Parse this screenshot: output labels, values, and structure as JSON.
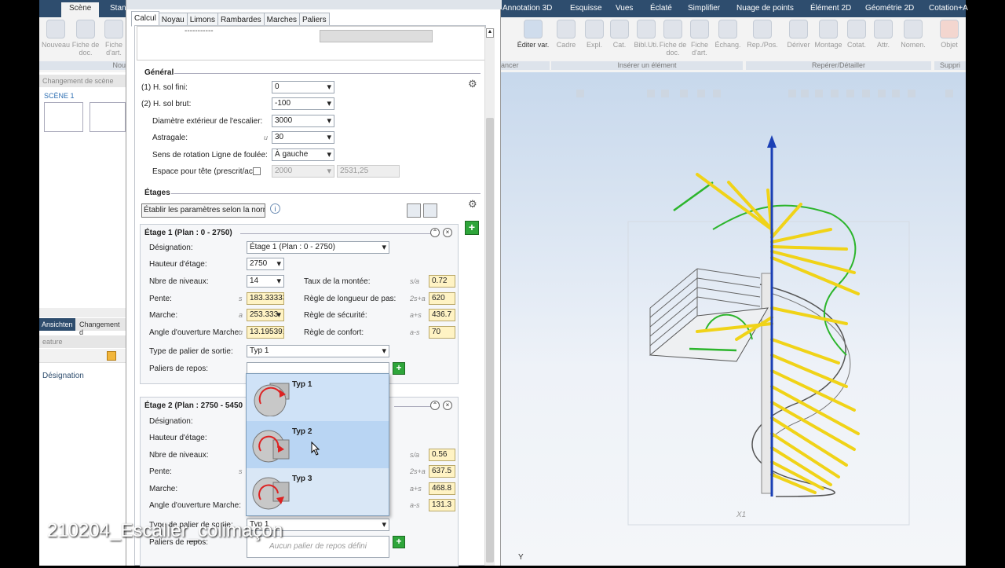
{
  "ribbon": {
    "tabs": [
      "Scène",
      "Stan",
      "Annotation 3D",
      "Esquisse",
      "Vues",
      "Éclaté",
      "Simplifier",
      "Nuage de points",
      "Élément 2D",
      "Géométrie 2D",
      "Cotation+A"
    ],
    "buttons_left": [
      "Nouveau",
      "Fiche de doc.",
      "Fiche d'art."
    ],
    "group_left": "Nou",
    "buttons_mid": [
      "Éditer var."
    ],
    "group_mid_left": "ancer",
    "buttons_insert": [
      "Cadre",
      "Expl.",
      "Cat.",
      "Bibl.Uti.",
      "Fiche de doc.",
      "Fiche d'art.",
      "Échang."
    ],
    "group_insert": "Insérer un élément",
    "buttons_rep": [
      "Rep./Pos.",
      "Dériver",
      "Montage",
      "Cotat.",
      "Attr.",
      "Nomen."
    ],
    "group_rep": "Repérer/Détailler",
    "buttons_right": [
      "Objet"
    ],
    "group_right": "Suppri"
  },
  "scene_pane": {
    "header": "Changement de scène",
    "scene_label": "SCÈNE 1",
    "tabs": [
      "Ansichten",
      "Changement d"
    ],
    "feature_header": "eature",
    "list_item": "Désignation"
  },
  "dialog": {
    "tabs": [
      "Calcul",
      "Noyau",
      "Limons",
      "Rambardes",
      "Marches",
      "Paliers"
    ],
    "active_tab": "Calcul",
    "top_dashes": "-----------",
    "general": {
      "title": "Général",
      "rows": [
        {
          "label": "(1) H. sol fini:",
          "value": "0"
        },
        {
          "label": "(2) H. sol brut:",
          "value": "-100"
        },
        {
          "label": "Diamètre extérieur de l'escalier:",
          "value": "3000"
        },
        {
          "label": "Astragale:",
          "unit": "u",
          "value": "30"
        },
        {
          "label": "Sens de rotation Ligne de foulée:",
          "value": "À gauche"
        },
        {
          "label": "Espace pour tête (prescrit/actu",
          "value": "2000",
          "value2": "2531,25"
        }
      ]
    },
    "etages": {
      "title": "Étages",
      "norm_button": "Établir les paramètres selon la norme"
    },
    "etage1": {
      "title": "Étage 1 (Plan : 0 - 2750)",
      "designation_label": "Désignation:",
      "designation_value": "Étage 1 (Plan : 0 - 2750)",
      "hauteur_label": "Hauteur d'étage:",
      "hauteur_value": "2750",
      "niveaux_label": "Nbre de niveaux:",
      "niveaux_value": "14",
      "taux_label": "Taux de la montée:",
      "taux_unit": "s/a",
      "taux_value": "0.72",
      "pente_label": "Pente:",
      "pente_unit": "s",
      "pente_value": "183.33333",
      "longueur_label": "Règle de longueur de pas:",
      "longueur_unit": "2s+a",
      "longueur_value": "620",
      "marche_label": "Marche:",
      "marche_unit": "a",
      "marche_value": "253.333",
      "securite_label": "Règle de sécurité:",
      "securite_unit": "a+s",
      "securite_value": "436.7",
      "angle_label": "Angle d'ouverture Marche:",
      "angle_unit": "α",
      "angle_value": "13.195391",
      "confort_label": "Règle de confort:",
      "confort_unit": "a-s",
      "confort_value": "70",
      "palier_label": "Type de palier de sortie:",
      "palier_value": "Typ 1",
      "repos_label": "Paliers de repos:"
    },
    "etage2": {
      "title": "Étage 2 (Plan : 2750 - 5450",
      "designation_label": "Désignation:",
      "hauteur_label": "Hauteur d'étage:",
      "niveaux_label": "Nbre de niveaux:",
      "taux_unit": "s/a",
      "taux_value": "0.56",
      "pente_label": "Pente:",
      "pente_unit": "s",
      "longueur_unit": "2s+a",
      "longueur_value": "637.5",
      "marche_label": "Marche:",
      "securite_unit": "a+s",
      "securite_value": "468.8",
      "angle_label": "Angle d'ouverture Marche:",
      "confort_unit": "a-s",
      "confort_value": "131.3",
      "palier_label": "Type de palier de sortie:",
      "palier_value": "Typ 1",
      "repos_label": "Paliers de repos:",
      "repos_value": "Aucun palier de repos défini"
    },
    "popup": [
      "Typ 1",
      "Typ 2",
      "Typ 3"
    ]
  },
  "viewport": {
    "axis_labels": [
      "X1",
      "Y"
    ]
  },
  "caption": "210204_Escalier_colimaçon",
  "colors": {
    "ribbon_tab_bg": "#2e4d6e",
    "highlight": "#cfe2f7",
    "field_yellow": "#fff3c4",
    "plus_green": "#2ea53a"
  }
}
